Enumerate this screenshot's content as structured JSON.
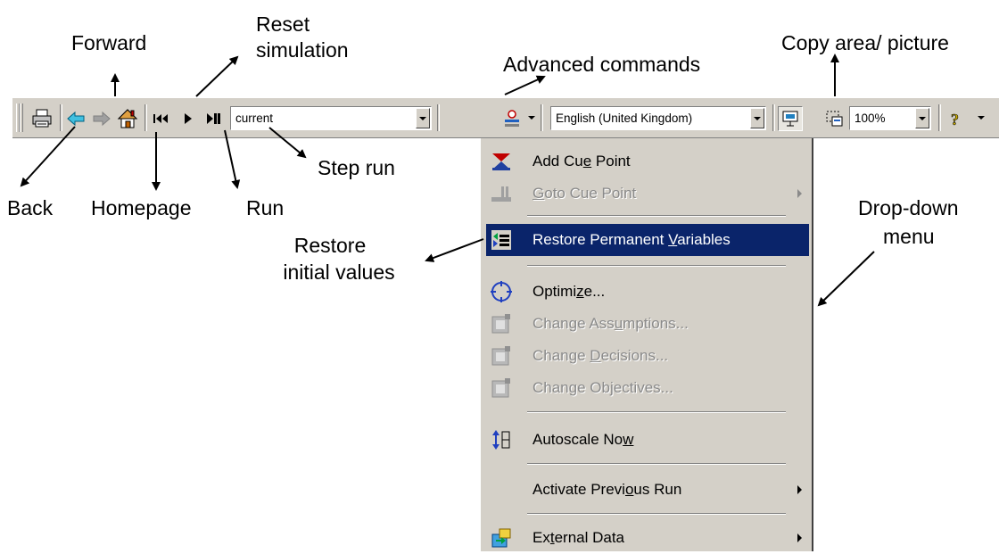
{
  "callouts": {
    "forward": "Forward",
    "reset_line1": "Reset",
    "reset_line2": "simulation",
    "advanced": "Advanced commands",
    "copy_area": "Copy area/ picture",
    "step_run": "Step run",
    "back": "Back",
    "homepage": "Homepage",
    "run": "Run",
    "restore_line1": "Restore",
    "restore_line2": "initial values",
    "dropdown_line1": "Drop-down",
    "dropdown_line2": "menu"
  },
  "toolbar": {
    "run_combo_value": "current",
    "language_value": "English (United Kingdom)",
    "zoom_value": "100%",
    "icons": [
      "print-icon",
      "back-arrow-icon",
      "forward-arrow-icon",
      "home-icon",
      "reset-icon",
      "run-icon",
      "step-run-icon",
      "advanced-commands-icon",
      "presentation-icon",
      "copy-area-icon",
      "help-icon"
    ]
  },
  "menu": {
    "items": [
      {
        "pre": "Add Cu",
        "acc": "e",
        "post": " Point",
        "enabled": true,
        "icon": "cue-point-icon"
      },
      {
        "pre": "",
        "acc": "G",
        "post": "oto Cue Point",
        "enabled": false,
        "submenu": true,
        "icon": "goto-cue-icon"
      },
      {
        "pre": "Restore Permanent ",
        "acc": "V",
        "post": "ariables",
        "enabled": true,
        "highlighted": true,
        "icon": "restore-icon"
      },
      {
        "pre": "Optimi",
        "acc": "z",
        "post": "e...",
        "enabled": true,
        "icon": "optimize-icon"
      },
      {
        "pre": "Change Ass",
        "acc": "u",
        "post": "mptions...",
        "enabled": false,
        "icon": "assumptions-icon"
      },
      {
        "pre": "Change ",
        "acc": "D",
        "post": "ecisions...",
        "enabled": false,
        "icon": "decisions-icon"
      },
      {
        "pre": "Change Ob",
        "acc": "j",
        "post": "ectives...",
        "enabled": false,
        "icon": "objectives-icon"
      },
      {
        "pre": "Autoscale No",
        "acc": "w",
        "post": "",
        "enabled": true,
        "icon": "autoscale-icon"
      },
      {
        "pre": "Activate Previ",
        "acc": "o",
        "post": "us Run",
        "enabled": true,
        "submenu": true
      },
      {
        "pre": "Ex",
        "acc": "t",
        "post": "ernal Data",
        "enabled": true,
        "submenu": true,
        "icon": "external-data-icon"
      }
    ]
  },
  "colors": {
    "toolbar_bg": "#d4d0c8",
    "highlight_bg": "#0a246a",
    "highlight_text": "#ffffff",
    "disabled_text": "#8a8a8a"
  }
}
